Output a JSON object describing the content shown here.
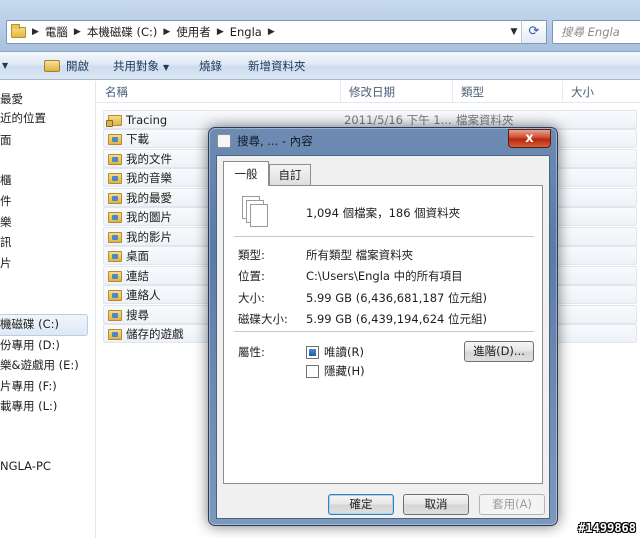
{
  "address": {
    "crumbs": [
      "電腦",
      "本機磁碟 (C:)",
      "使用者",
      "Engla"
    ],
    "search_placeholder": "搜尋 Engla"
  },
  "toolbar": {
    "open": "開啟",
    "share": "共用對象",
    "burn": "燒錄",
    "new_folder": "新增資料夾"
  },
  "nav": {
    "items": [
      {
        "label": "最愛"
      },
      {
        "label": "近的位置"
      },
      {
        "label": "面"
      },
      {
        "label": "櫃"
      },
      {
        "label": "件"
      },
      {
        "label": "樂"
      },
      {
        "label": "訊"
      },
      {
        "label": "片"
      },
      {
        "label": "機磁碟 (C:)"
      },
      {
        "label": "份專用 (D:)"
      },
      {
        "label": "樂&遊戲用 (E:)"
      },
      {
        "label": "片專用 (F:)"
      },
      {
        "label": "載專用 (L:)"
      },
      {
        "label": "NGLA-PC"
      }
    ]
  },
  "columns": [
    "名稱",
    "修改日期",
    "類型",
    "大小"
  ],
  "files": [
    {
      "name": "Tracing",
      "date": "2011/5/16 下午 1...",
      "type": "檔案資料夾"
    },
    {
      "name": "下載",
      "date": "",
      "type": ""
    },
    {
      "name": "我的文件",
      "date": "",
      "type": ""
    },
    {
      "name": "我的音樂",
      "date": "",
      "type": ""
    },
    {
      "name": "我的最愛",
      "date": "",
      "type": ""
    },
    {
      "name": "我的圖片",
      "date": "",
      "type": ""
    },
    {
      "name": "我的影片",
      "date": "",
      "type": ""
    },
    {
      "name": "桌面",
      "date": "",
      "type": ""
    },
    {
      "name": "連結",
      "date": "",
      "type": ""
    },
    {
      "name": "連絡人",
      "date": "",
      "type": ""
    },
    {
      "name": "搜尋",
      "date": "",
      "type": ""
    },
    {
      "name": "儲存的遊戲",
      "date": "",
      "type": ""
    }
  ],
  "dialog": {
    "title": "搜尋, ... - 內容",
    "close": "x",
    "tabs": [
      "一般",
      "自訂"
    ],
    "summary": "1,094 個檔案，186 個資料夾",
    "rows": {
      "type_label": "類型:",
      "type_value": "所有類型 檔案資料夾",
      "location_label": "位置:",
      "location_value": "C:\\Users\\Engla 中的所有項目",
      "size_label": "大小:",
      "size_value": "5.99 GB (6,436,681,187 位元組)",
      "disk_label": "磁碟大小:",
      "disk_value": "5.99 GB (6,439,194,624 位元組)",
      "attr_label": "屬性:"
    },
    "attributes": {
      "readonly": "唯讀(R)",
      "hidden": "隱藏(H)",
      "advanced": "進階(D)..."
    },
    "buttons": {
      "ok": "確定",
      "cancel": "取消",
      "apply": "套用(A)"
    }
  },
  "watermark": "#1499868"
}
